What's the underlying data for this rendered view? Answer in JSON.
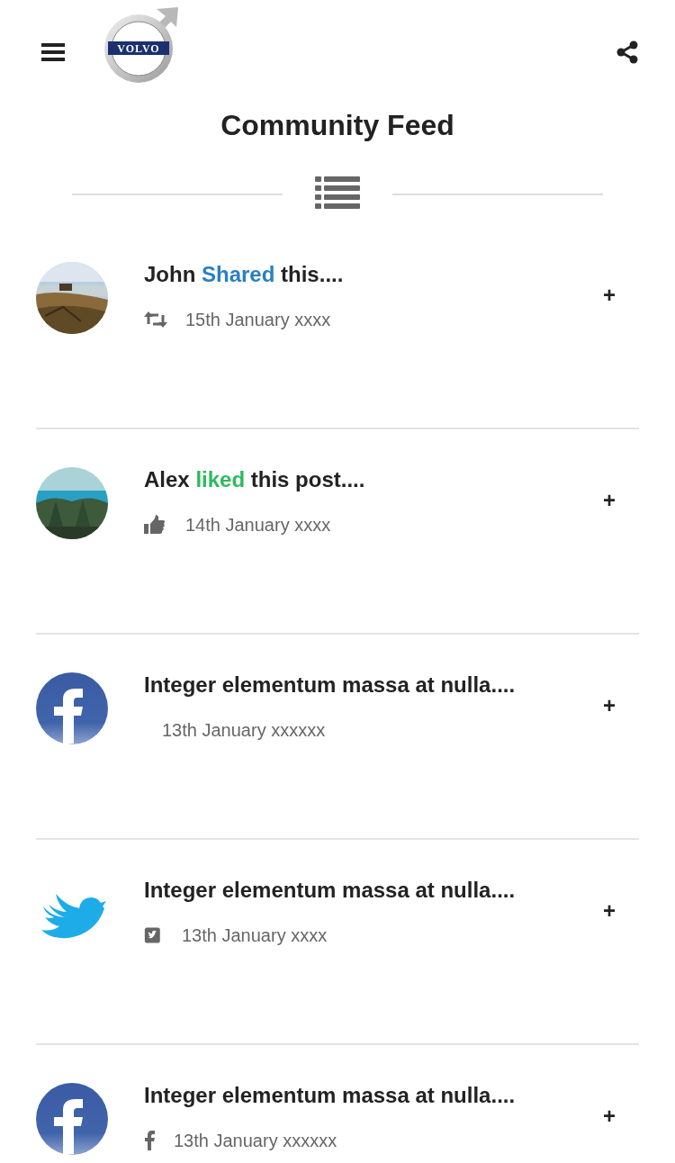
{
  "header": {
    "logo_text": "VOLVO",
    "title": "Community Feed"
  },
  "feed": [
    {
      "avatar": {
        "kind": "shore"
      },
      "title": [
        {
          "text": "John "
        },
        {
          "text": "Shared",
          "color": "#2a7fc0"
        },
        {
          "text": " this...."
        }
      ],
      "meta_icon": {
        "kind": "retweet"
      },
      "date": "15th January xxxx",
      "action": "+"
    },
    {
      "avatar": {
        "kind": "sea"
      },
      "title": [
        {
          "text": "Alex "
        },
        {
          "text": "liked",
          "color": "#2dbb5d"
        },
        {
          "text": " this post...."
        }
      ],
      "meta_icon": {
        "kind": "like"
      },
      "date": "14th January xxxx",
      "action": "+"
    },
    {
      "avatar": {
        "kind": "facebook"
      },
      "title": [
        {
          "text": "Integer elementum massa at nulla...."
        }
      ],
      "date": "13th January xxxxxx",
      "action": "+"
    },
    {
      "avatar": {
        "kind": "twitter"
      },
      "title": [
        {
          "text": "Integer elementum massa at nulla...."
        }
      ],
      "meta_icon": {
        "kind": "twitter"
      },
      "date": "13th January xxxx",
      "action": "+"
    },
    {
      "avatar": {
        "kind": "facebook"
      },
      "title": [
        {
          "text": "Integer elementum massa at nulla...."
        }
      ],
      "meta_icon": {
        "kind": "facebook"
      },
      "date": "13th January xxxxxx",
      "action": "+"
    }
  ]
}
